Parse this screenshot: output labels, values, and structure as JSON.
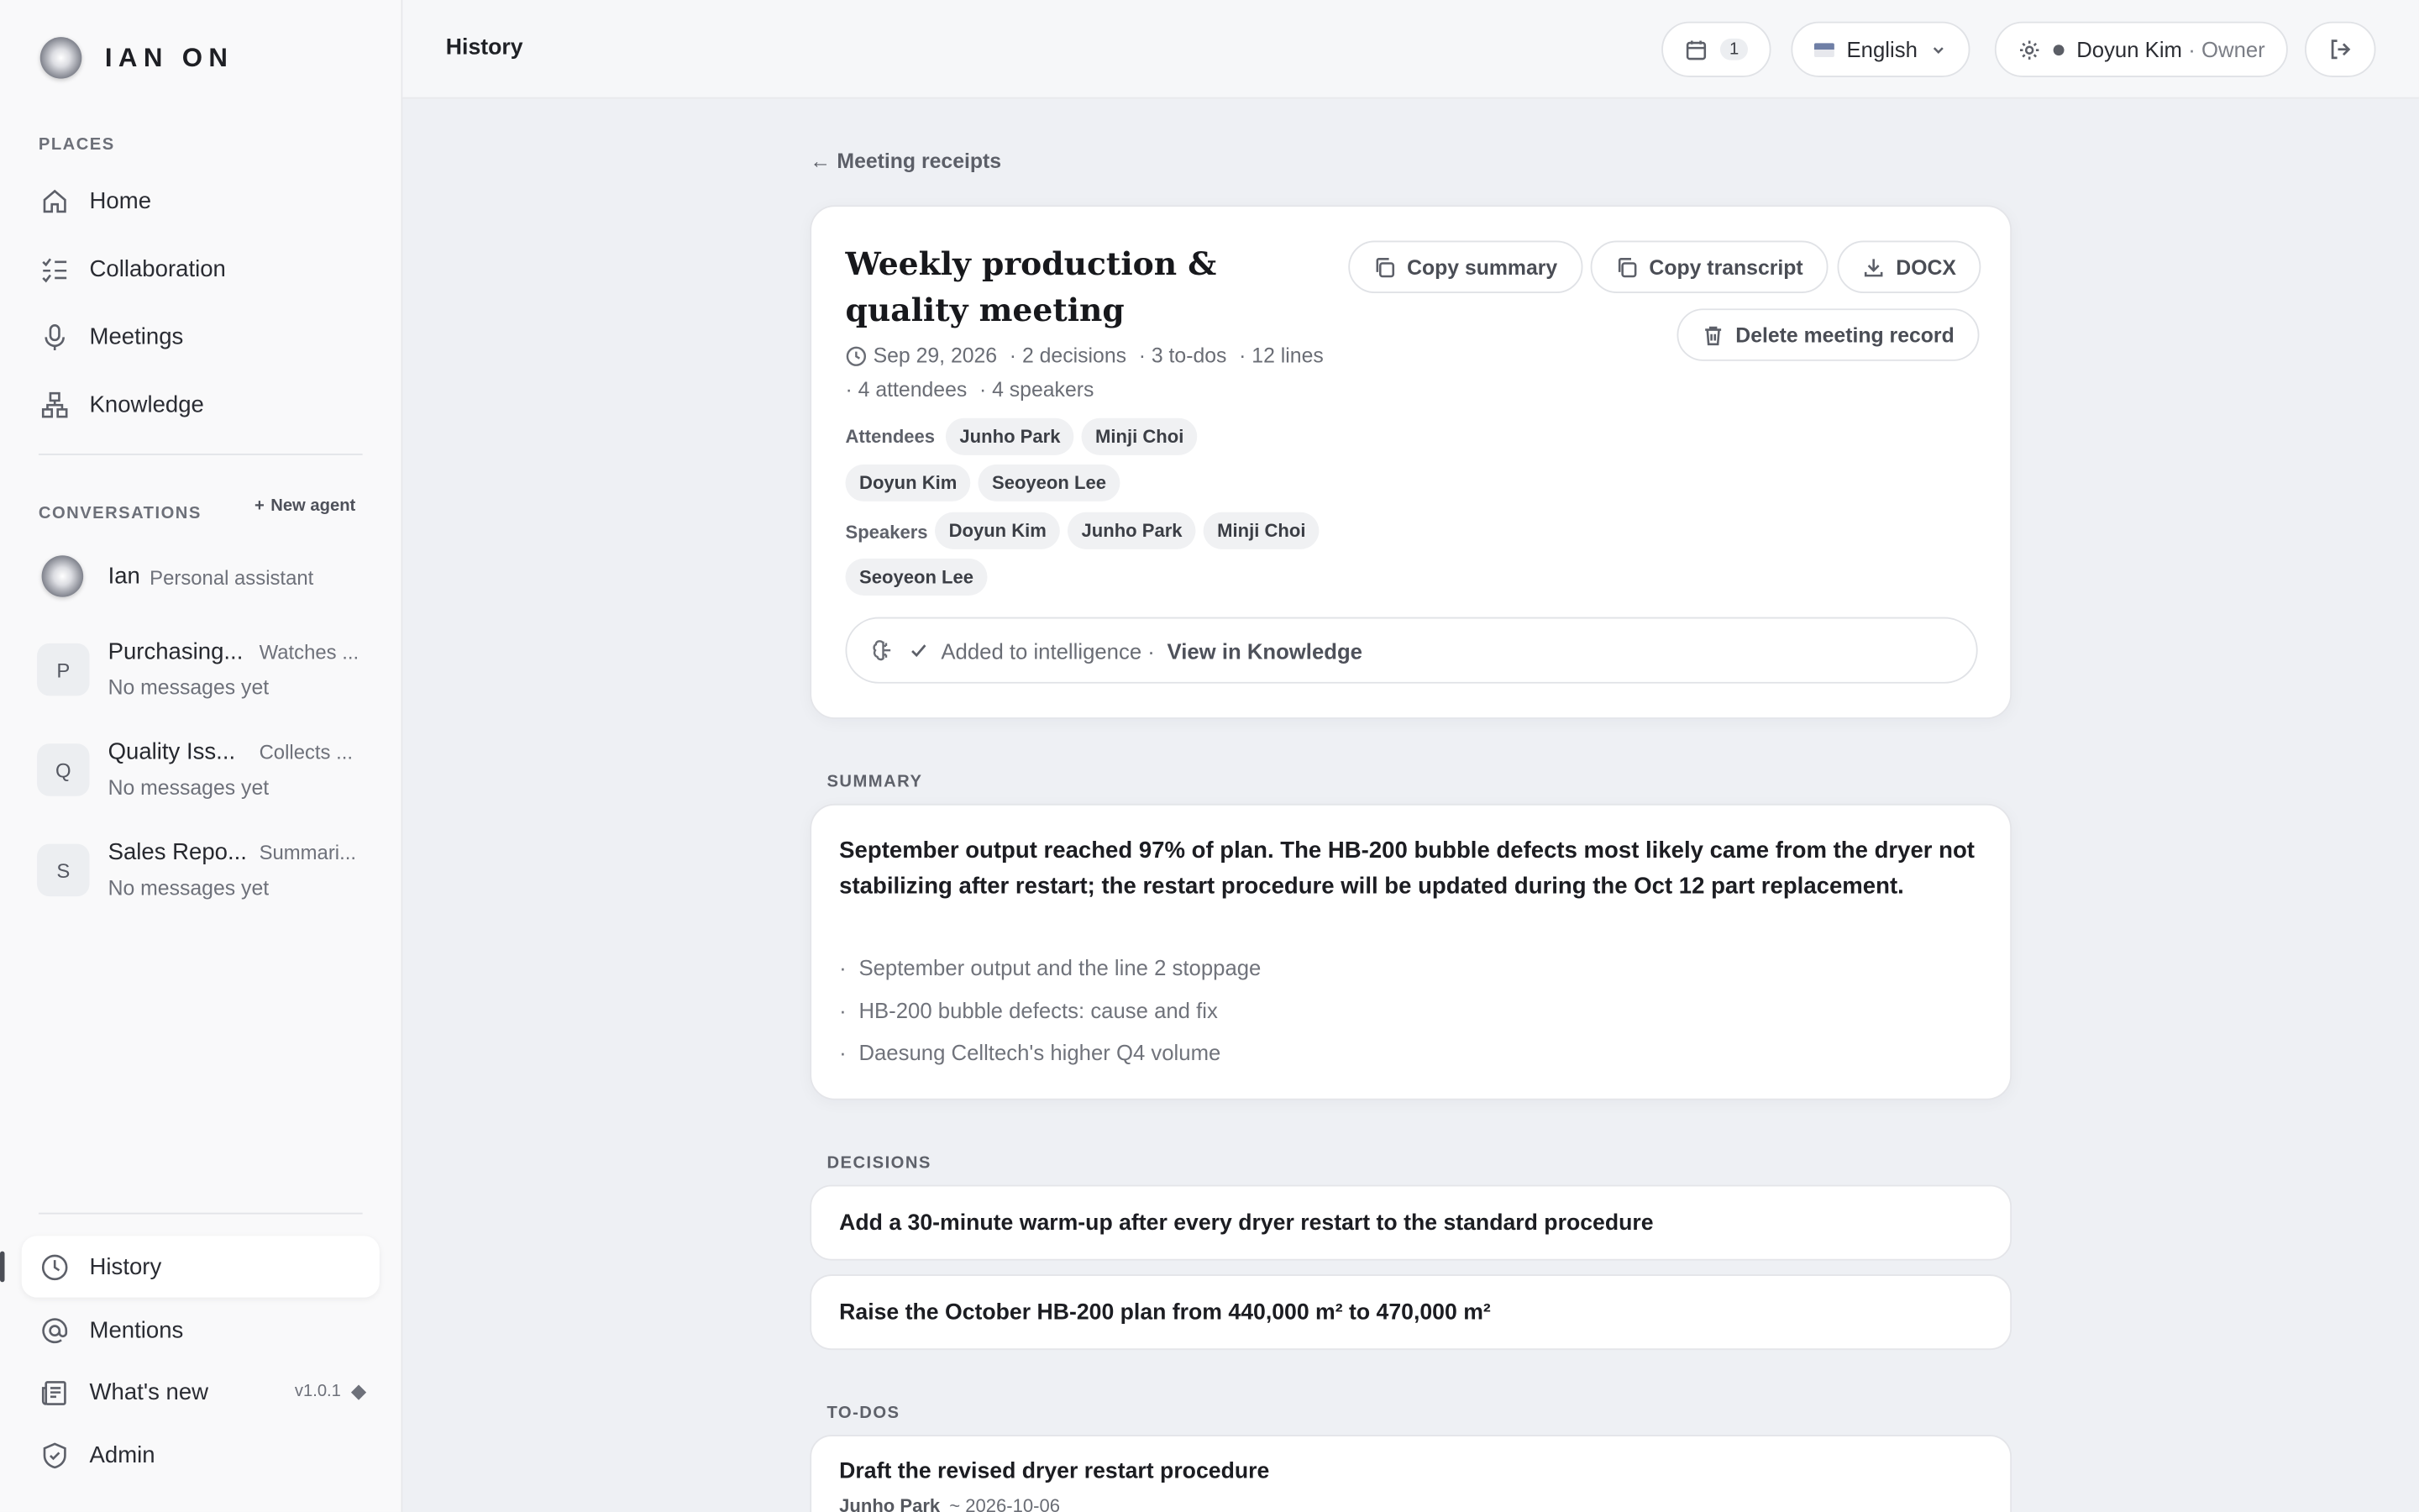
{
  "brand": {
    "name": "IAN ON"
  },
  "sidebar": {
    "places_label": "PLACES",
    "places": [
      {
        "label": "Home",
        "icon": "home-icon"
      },
      {
        "label": "Collaboration",
        "icon": "checklist-icon"
      },
      {
        "label": "Meetings",
        "icon": "microphone-icon"
      },
      {
        "label": "Knowledge",
        "icon": "hierarchy-icon"
      }
    ],
    "conversations_label": "CONVERSATIONS",
    "new_agent_label": "New agent",
    "conversations": [
      {
        "title": "Ian",
        "subtitle": "Personal assistant",
        "avatar": ""
      },
      {
        "title": "Purchasing...",
        "subtitle": "Watches ...",
        "message": "No messages yet",
        "avatar": "P"
      },
      {
        "title": "Quality Iss...",
        "subtitle": "Collects ...",
        "message": "No messages yet",
        "avatar": "Q"
      },
      {
        "title": "Sales Repo...",
        "subtitle": "Summari...",
        "message": "No messages yet",
        "avatar": "S"
      }
    ],
    "bottom": [
      {
        "label": "History",
        "icon": "clock-icon",
        "active": true
      },
      {
        "label": "Mentions",
        "icon": "at-icon"
      },
      {
        "label": "What's new",
        "icon": "newspaper-icon",
        "version": "v1.0.1"
      },
      {
        "label": "Admin",
        "icon": "shield-icon"
      }
    ]
  },
  "topbar": {
    "title": "History",
    "calendar_count": "1",
    "language": "English",
    "user_name": "Doyun Kim",
    "user_role": "· Owner"
  },
  "main": {
    "back_label": "Meeting receipts",
    "meeting": {
      "title": "Weekly production & quality meeting",
      "date": "Sep 29, 2026",
      "decisions_count": "· 2 decisions",
      "todos_count": "· 3 to-dos",
      "lines_count": "· 12 lines",
      "attendees_count": "· 4 attendees",
      "speakers_count": "· 4 speakers",
      "attendees_label": "Attendees",
      "attendees": [
        "Junho Park",
        "Minji Choi",
        "Doyun Kim",
        "Seoyeon Lee"
      ],
      "speakers_label": "Speakers",
      "speakers": [
        "Doyun Kim",
        "Junho Park",
        "Minji Choi",
        "Seoyeon Lee"
      ],
      "buttons": {
        "copy_summary": "Copy summary",
        "copy_transcript": "Copy transcript",
        "docx": "DOCX",
        "delete": "Delete meeting record"
      },
      "intel_text": "Added to intelligence ·",
      "intel_link": "View in Knowledge"
    },
    "summary_label": "SUMMARY",
    "summary_text": "September output reached 97% of plan. The HB-200 bubble defects most likely came from the dryer not stabilizing after restart; the restart procedure will be updated during the Oct 12 part replacement.",
    "summary_bullets": [
      "September output and the line 2 stoppage",
      "HB-200 bubble defects: cause and fix",
      "Daesung Celltech's higher Q4 volume"
    ],
    "decisions_label": "DECISIONS",
    "decisions": [
      "Add a 30-minute warm-up after every dryer restart to the standard procedure",
      "Raise the October HB-200 plan from 440,000 m² to 470,000 m²"
    ],
    "todos_label": "TO-DOS",
    "todos": [
      {
        "title": "Draft the revised dryer restart procedure",
        "owner": "Junho Park",
        "due": "~ 2026-10-06"
      }
    ]
  }
}
